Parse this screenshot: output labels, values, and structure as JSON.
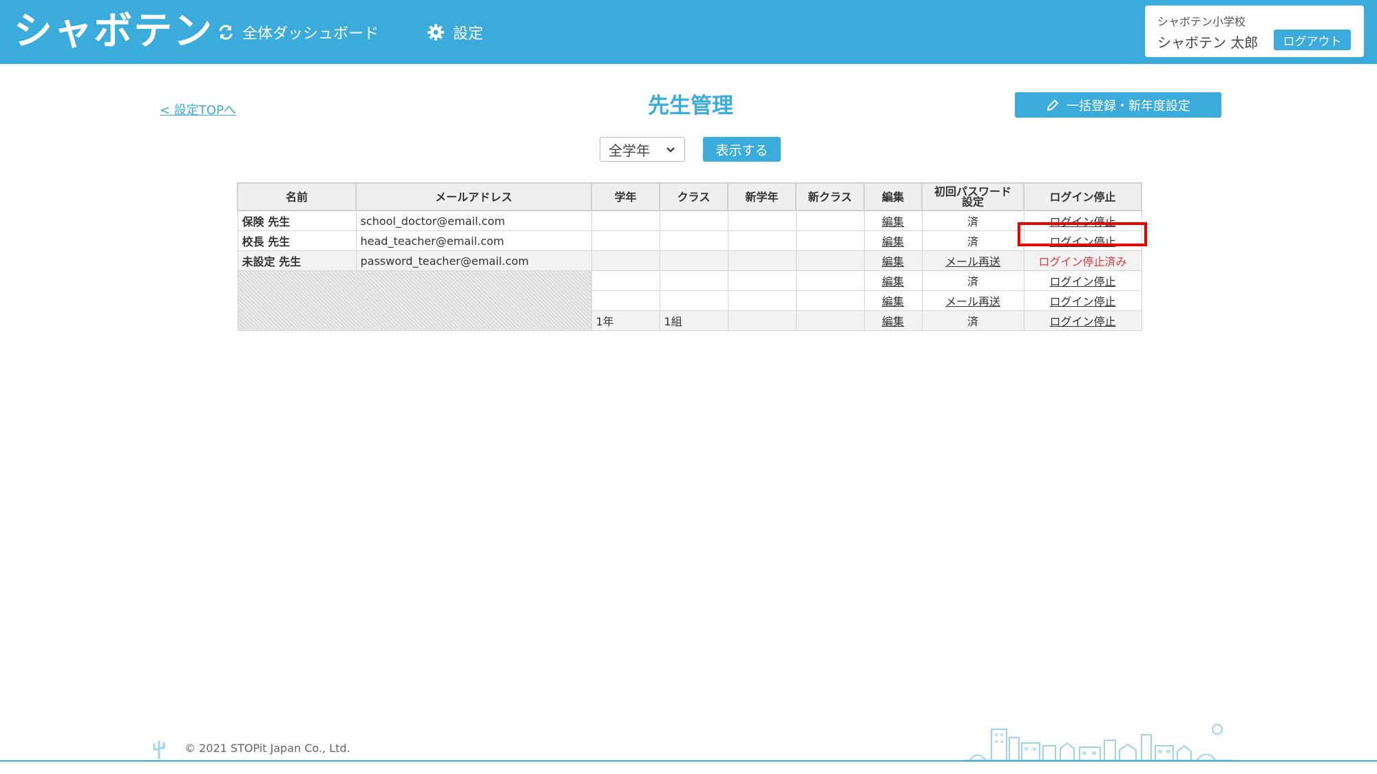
{
  "header": {
    "logo": "シャボテン",
    "nav": [
      {
        "label": "全体ダッシュボード",
        "icon": "sync-icon"
      },
      {
        "label": "設定",
        "icon": "gear-icon"
      }
    ],
    "school_name": "シャボテン小学校",
    "user_name": "シャボテン 太郎",
    "logout_label": "ログアウト"
  },
  "page": {
    "back_link": "< 設定TOPへ",
    "title": "先生管理",
    "bulk_button": "一括登録・新年度設定",
    "grade_select_value": "全学年",
    "show_button": "表示する"
  },
  "table": {
    "headers": [
      "名前",
      "メールアドレス",
      "学年",
      "クラス",
      "新学年",
      "新クラス",
      "編集",
      "初回パスワード設定",
      "ログイン停止"
    ],
    "header_pw_line1": "初回パスワード",
    "header_pw_line2": "設定",
    "rows": [
      {
        "name": "保険 先生",
        "email": "school_doctor@email.com",
        "grade": "",
        "class": "",
        "new_grade": "",
        "new_class": "",
        "edit": "編集",
        "password": "済",
        "login": "ログイン停止"
      },
      {
        "name": "校長 先生",
        "email": "head_teacher@email.com",
        "grade": "",
        "class": "",
        "new_grade": "",
        "new_class": "",
        "edit": "編集",
        "password": "済",
        "login": "ログイン停止"
      },
      {
        "name": "未設定 先生",
        "email": "password_teacher@email.com",
        "grade": "",
        "class": "",
        "new_grade": "",
        "new_class": "",
        "edit": "編集",
        "password": "メール再送",
        "login": "ログイン停止済み"
      },
      {
        "name": "",
        "email": "",
        "grade": "",
        "class": "",
        "new_grade": "",
        "new_class": "",
        "edit": "編集",
        "password": "済",
        "login": "ログイン停止"
      },
      {
        "name": "",
        "email": "",
        "grade": "",
        "class": "",
        "new_grade": "",
        "new_class": "",
        "edit": "編集",
        "password": "メール再送",
        "login": "ログイン停止"
      },
      {
        "name": "",
        "email": "",
        "grade": "1年",
        "class": "1組",
        "new_grade": "",
        "new_class": "",
        "edit": "編集",
        "password": "済",
        "login": "ログイン停止"
      }
    ]
  },
  "footer": {
    "copyright": "© 2021 STOPit Japan Co., Ltd."
  },
  "colors": {
    "accent": "#3aabdb",
    "highlight": "#e20000",
    "stopped_text": "#e03a3a"
  }
}
